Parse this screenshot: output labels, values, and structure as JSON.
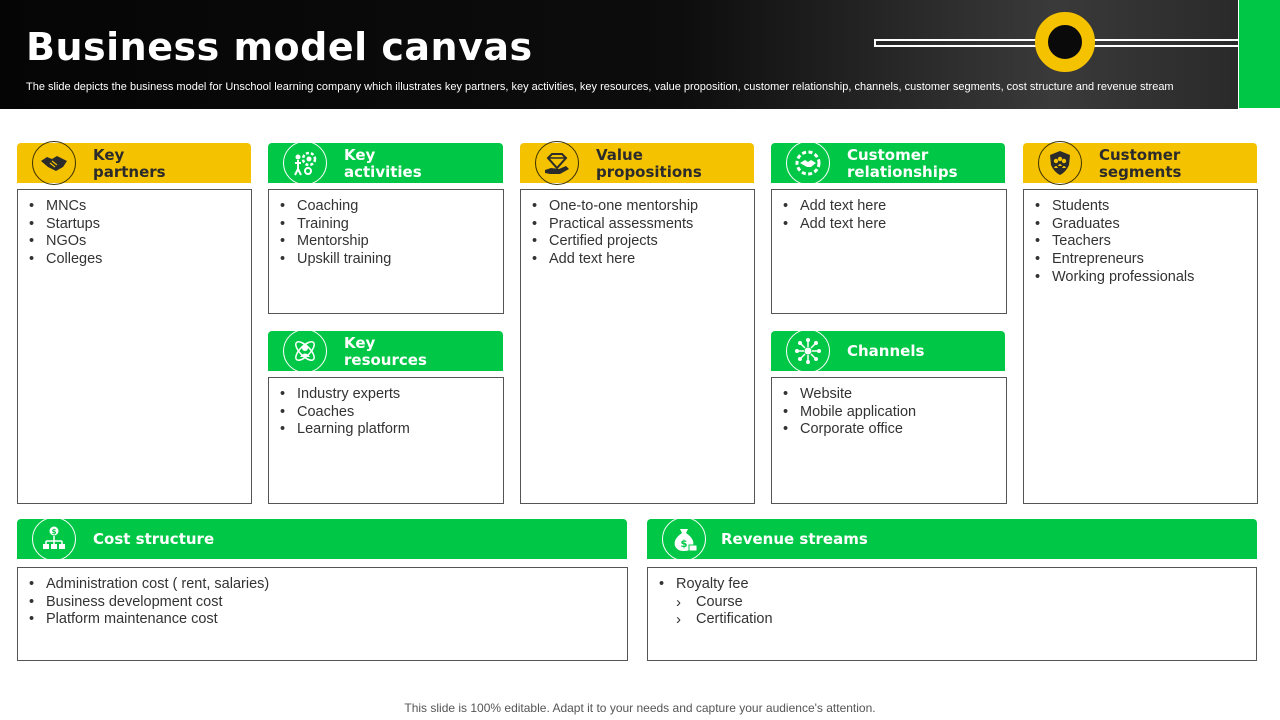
{
  "header": {
    "title": "Business model canvas",
    "subtitle": "The slide depicts the business model for Unschool learning company which illustrates key partners, key activities, key resources, value proposition, customer relationship, channels, customer segments, cost structure and revenue stream"
  },
  "sections": {
    "key_partners": {
      "title": "Key partners",
      "items": [
        "MNCs",
        "Startups",
        "NGOs",
        "Colleges"
      ]
    },
    "key_activities": {
      "title": "Key activities",
      "items": [
        "Coaching",
        "Training",
        "Mentorship",
        "Upskill training"
      ]
    },
    "key_resources": {
      "title": "Key resources",
      "items": [
        "Industry experts",
        "Coaches",
        "Learning platform"
      ]
    },
    "value_propositions": {
      "title": "Value propositions",
      "items": [
        "One-to-one mentorship",
        "Practical assessments",
        "Certified projects",
        "Add text here"
      ]
    },
    "customer_relationships": {
      "title": "Customer relationships",
      "items": [
        "Add text here",
        "Add text here"
      ]
    },
    "channels": {
      "title": "Channels",
      "items": [
        "Website",
        "Mobile application",
        "Corporate office"
      ]
    },
    "customer_segments": {
      "title": "Customer segments",
      "items": [
        "Students",
        "Graduates",
        "Teachers",
        "Entrepreneurs",
        "Working professionals"
      ]
    },
    "cost_structure": {
      "title": "Cost structure",
      "items": [
        "Administration cost ( rent, salaries)",
        "Business development cost",
        "Platform maintenance cost"
      ]
    },
    "revenue_streams": {
      "title": "Revenue streams",
      "items": [
        "Royalty fee"
      ],
      "sub_items": [
        "Course",
        "Certification"
      ]
    }
  },
  "footer": {
    "note": "This slide is 100% editable. Adapt it to your needs and capture your audience's attention."
  },
  "colors": {
    "yellow": "#f5c200",
    "green": "#00c846",
    "header_bg": "#0a0a0a"
  },
  "icons": {
    "key_partners": "handshake-icon",
    "key_activities": "gear-person-icon",
    "key_resources": "atom-person-icon",
    "value_propositions": "hand-diamond-icon",
    "customer_relationships": "handshake-gear-icon",
    "channels": "network-icon",
    "customer_segments": "people-shield-icon",
    "cost_structure": "hierarchy-dollar-icon",
    "revenue_streams": "money-bag-icon"
  }
}
